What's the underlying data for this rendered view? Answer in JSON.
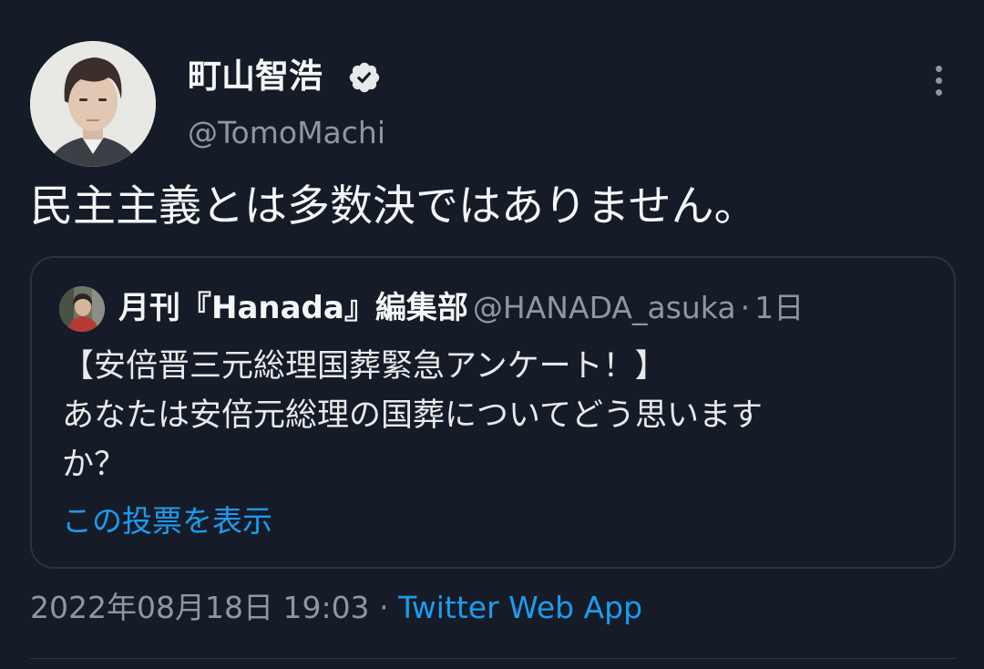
{
  "author": {
    "display_name": "町山智浩",
    "handle": "@TomoMachi",
    "verified": true
  },
  "tweet": {
    "text": "民主主義とは多数決ではありません。"
  },
  "quoted_tweet": {
    "display_name": "月刊『Hanada』編集部",
    "handle": "@HANADA_asuka",
    "separator": "·",
    "time": "1日",
    "text_lines": [
      "【安倍晋三元総理国葬緊急アンケート！】",
      "あなたは安倍元総理の国葬についてどう思います",
      "か？"
    ],
    "poll_link": "この投票を表示"
  },
  "meta": {
    "timestamp": "2022年08月18日 19:03",
    "separator": "·",
    "source": "Twitter Web App"
  },
  "icons": {
    "verified": "verified-badge-icon",
    "more": "more-vertical-icon"
  },
  "colors": {
    "background": "#151c27",
    "link": "#1d9bf0",
    "secondary_text": "#8b98a5",
    "border": "#2a3340"
  }
}
